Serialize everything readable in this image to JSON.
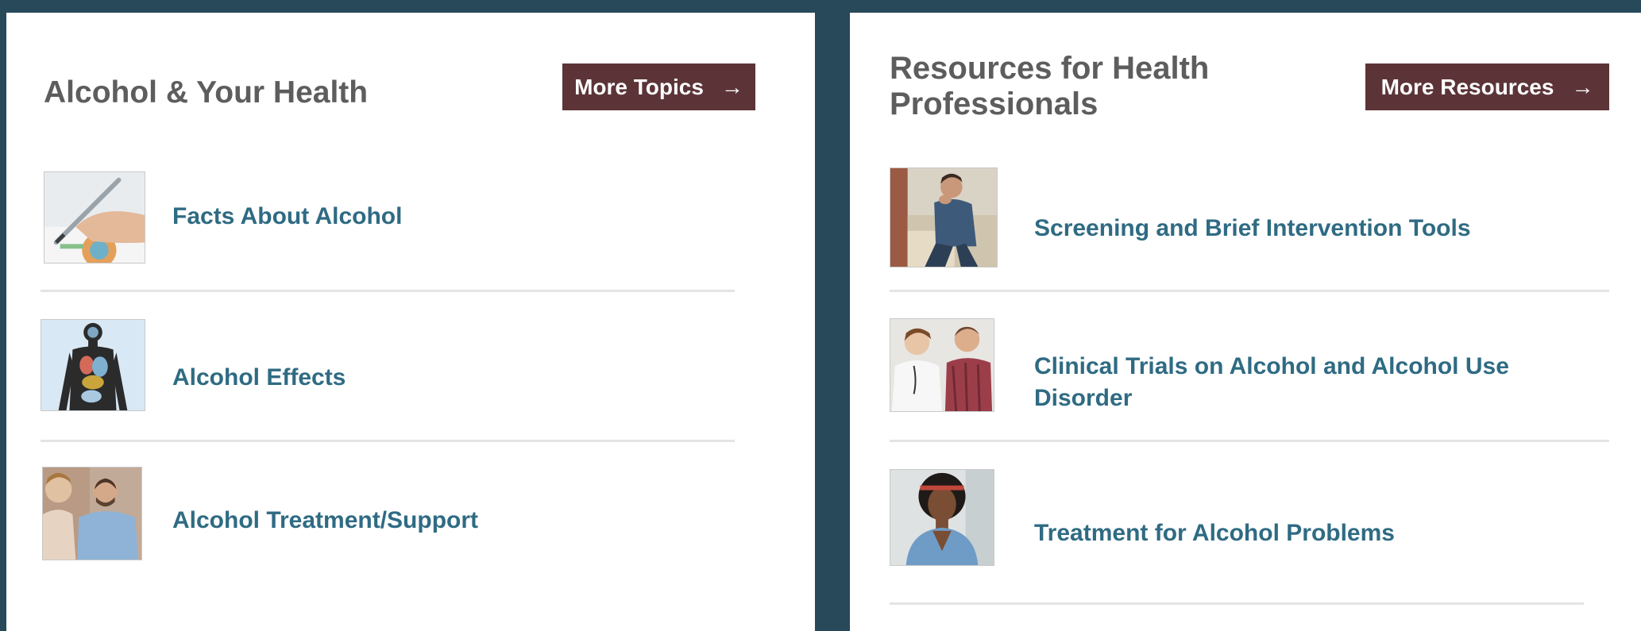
{
  "left_panel": {
    "title": "Alcohol & Your Health",
    "button_label": "More Topics",
    "button_arrow": "→",
    "items": [
      {
        "label": "Facts About Alcohol",
        "image": "hand-writing-chart-photo"
      },
      {
        "label": "Alcohol Effects",
        "image": "body-organs-illustration"
      },
      {
        "label": "Alcohol Treatment/Support",
        "image": "people-talking-photo"
      }
    ]
  },
  "right_panel": {
    "title": "Resources for Health Professionals",
    "button_label": "More Resources",
    "button_arrow": "→",
    "items": [
      {
        "label": "Screening and Brief Intervention Tools",
        "image": "man-seated-head-in-hand-photo"
      },
      {
        "label": "Clinical Trials on Alcohol and Alcohol Use Disorder",
        "image": "doctor-with-patient-photo"
      },
      {
        "label": "Treatment for Alcohol Problems",
        "image": "woman-portrait-photo"
      }
    ]
  },
  "colors": {
    "background": "#27495a",
    "button": "#5c3438",
    "link": "#2f6b83",
    "title": "#5d5d5d"
  }
}
